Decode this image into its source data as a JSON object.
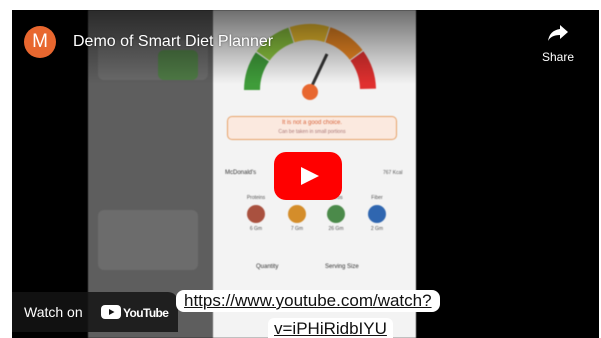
{
  "video": {
    "title": "Demo of Smart Diet Planner",
    "channel_initial": "M",
    "share_label": "Share",
    "watch_on_label": "Watch on",
    "platform_label": "YouTube"
  },
  "app_preview": {
    "warning_title": "It is not a good choice.",
    "warning_sub": "Can be taken in small portions",
    "food_name": "McDonald's",
    "calories": "767 Kcal",
    "macros": [
      {
        "label": "Proteins",
        "value": "6 Gm",
        "color": "#a9513f"
      },
      {
        "label": "Fats",
        "value": "7 Gm",
        "color": "#d48d2a"
      },
      {
        "label": "Carbs",
        "value": "26 Gm",
        "color": "#4b8a4a"
      },
      {
        "label": "Fiber",
        "value": "2 Gm",
        "color": "#2f66b0"
      }
    ],
    "quantity_label": "Quantity",
    "serving_label": "Serving Size",
    "gauge_colors": [
      "#3f9c3a",
      "#8cc63f",
      "#f2c230",
      "#f08a24",
      "#e0302f"
    ]
  },
  "link": {
    "line1": "https://www.youtube.com/watch?",
    "line2": "v=iPHiRidbIYU"
  },
  "colors": {
    "play_red": "#ff0000",
    "avatar": "#e8672f"
  }
}
